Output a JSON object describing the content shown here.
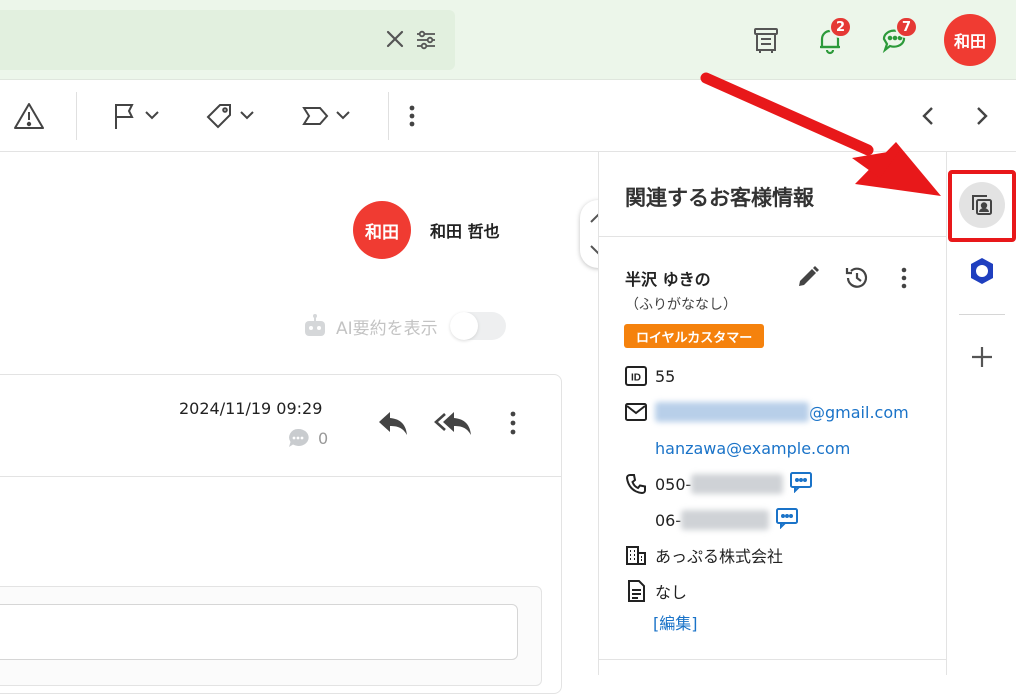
{
  "header": {
    "notifications_count": "2",
    "chat_count": "7",
    "user_initials": "和田"
  },
  "message": {
    "sender_initials": "和田",
    "sender_name": "和田 哲也",
    "ai_summary_label": "AI要約を表示",
    "date": "2024/11/19 09:29",
    "comment_count": "0"
  },
  "customer_panel": {
    "title": "関連するお客様情報",
    "name": "半沢 ゆきの",
    "kana": "（ふりがななし）",
    "tag": "ロイヤルカスタマー",
    "id": "55",
    "email_suffix": "@gmail.com",
    "email2": "hanzawa@example.com",
    "phone1_prefix": "050-",
    "phone2_prefix": "06-",
    "company": "あっぷる株式会社",
    "note": "なし",
    "edit_link": "[編集]"
  },
  "colors": {
    "accent_red": "#f03b32",
    "tag_orange": "#f5820d",
    "link_blue": "#1a73c8",
    "highlight_red": "#e8181a",
    "header_bg": "#ecf6ea"
  }
}
